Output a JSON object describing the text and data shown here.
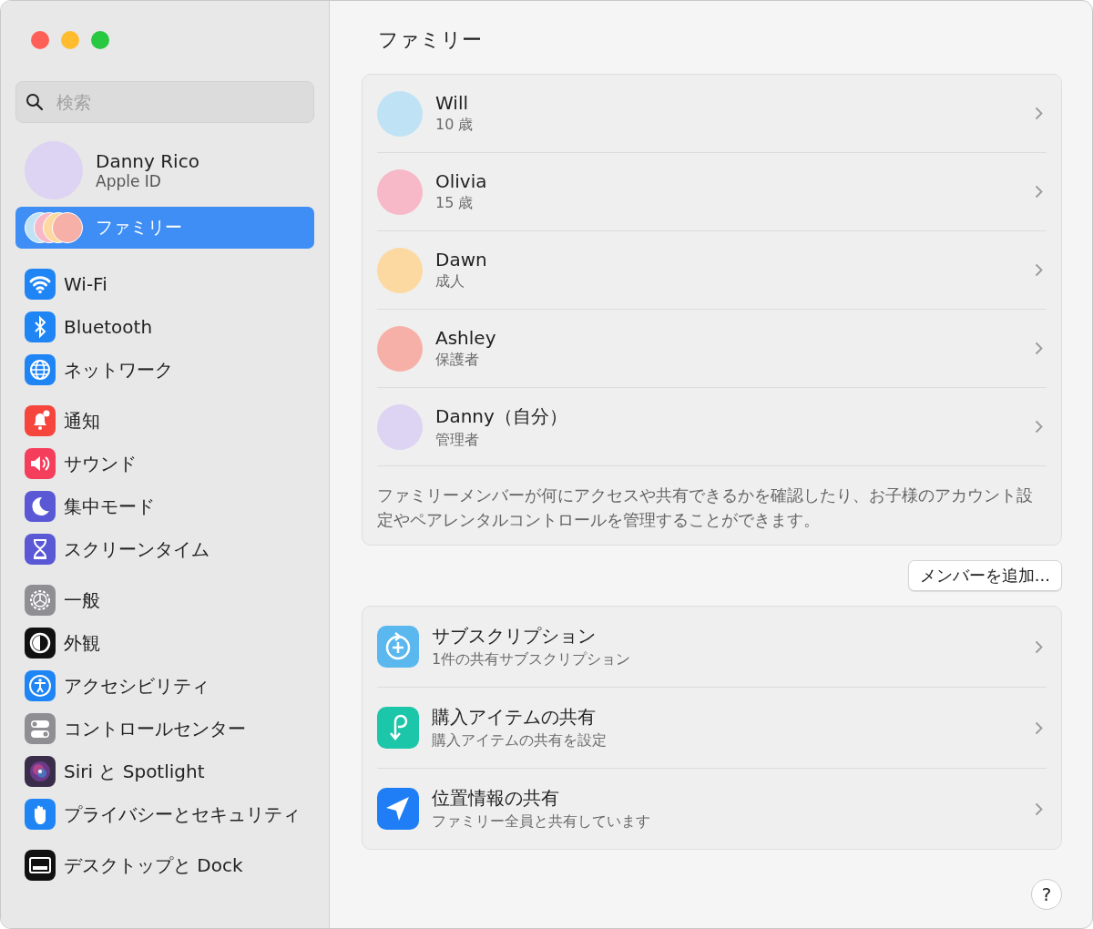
{
  "search": {
    "placeholder": "検索"
  },
  "account": {
    "name": "Danny Rico",
    "subtitle": "Apple ID"
  },
  "sidebar": {
    "family_item": {
      "label": "ファミリー",
      "selected": true
    },
    "groups": [
      [
        {
          "kind": "wifi",
          "label": "Wi-Fi",
          "selected": false
        },
        {
          "kind": "bluetooth",
          "label": "Bluetooth",
          "selected": false
        },
        {
          "kind": "network",
          "label": "ネットワーク",
          "selected": false
        }
      ],
      [
        {
          "kind": "notifications",
          "label": "通知",
          "selected": false
        },
        {
          "kind": "sound",
          "label": "サウンド",
          "selected": false
        },
        {
          "kind": "focus",
          "label": "集中モード",
          "selected": false
        },
        {
          "kind": "screentime",
          "label": "スクリーンタイム",
          "selected": false
        }
      ],
      [
        {
          "kind": "general",
          "label": "一般",
          "selected": false
        },
        {
          "kind": "appearance",
          "label": "外観",
          "selected": false
        },
        {
          "kind": "accessibility",
          "label": "アクセシビリティ",
          "selected": false
        },
        {
          "kind": "control",
          "label": "コントロールセンター",
          "selected": false
        },
        {
          "kind": "siri",
          "label": "Siri と Spotlight",
          "selected": false
        },
        {
          "kind": "privacy",
          "label": "プライバシーとセキュリティ",
          "selected": false
        }
      ],
      [
        {
          "kind": "desktop",
          "label": "デスクトップと Dock",
          "selected": false
        }
      ]
    ]
  },
  "title": "ファミリー",
  "members": [
    {
      "name": "Will",
      "role": "10 歳",
      "color": "#bfe3f5"
    },
    {
      "name": "Olivia",
      "role": "15 歳",
      "color": "#f7b8c8"
    },
    {
      "name": "Dawn",
      "role": "成人",
      "color": "#fbd9a0"
    },
    {
      "name": "Ashley",
      "role": "保護者",
      "color": "#f7b0a8"
    },
    {
      "name": "Danny（自分）",
      "role": "管理者",
      "color": "#ddd3f2"
    }
  ],
  "description": "ファミリーメンバーが何にアクセスや共有できるかを確認したり、お子様のアカウント設定やペアレンタルコントロールを管理することができます。",
  "add_button": "メンバーを追加...",
  "services": [
    {
      "kind": "subscription",
      "title": "サブスクリプション",
      "subtitle": "1件の共有サブスクリプション"
    },
    {
      "kind": "purchase",
      "title": "購入アイテムの共有",
      "subtitle": "購入アイテムの共有を設定"
    },
    {
      "kind": "location",
      "title": "位置情報の共有",
      "subtitle": "ファミリー全員と共有しています"
    }
  ],
  "help_button": "?"
}
